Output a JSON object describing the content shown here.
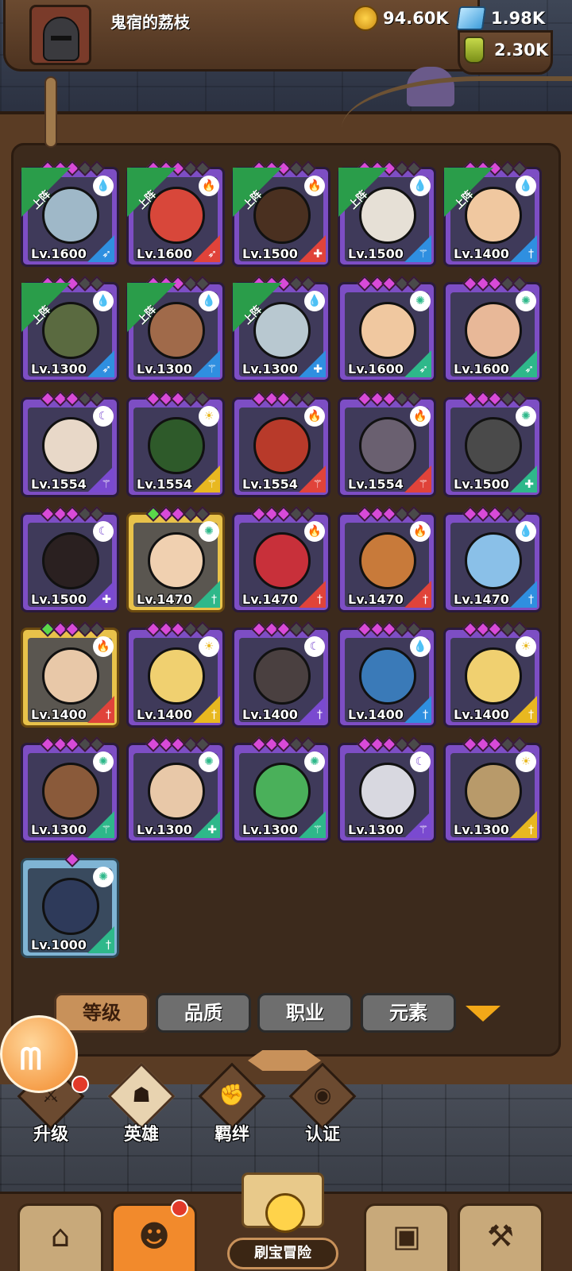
{
  "player": {
    "name": "鬼宿的荔枝"
  },
  "currencies": {
    "gold": "94.60K",
    "gems": "1.98K",
    "potion": "2.30K"
  },
  "heroes": [
    {
      "level": "Lv.1600",
      "deployed": true,
      "frame": "purple",
      "element": "water",
      "class": "archer",
      "face": "#9fb8c8"
    },
    {
      "level": "Lv.1600",
      "deployed": true,
      "frame": "purple",
      "element": "fire",
      "class": "archer",
      "face": "#d8473a"
    },
    {
      "level": "Lv.1500",
      "deployed": true,
      "frame": "purple",
      "element": "fire",
      "class": "tank",
      "face": "#4a3020"
    },
    {
      "level": "Lv.1500",
      "deployed": true,
      "frame": "purple",
      "element": "water",
      "class": "mage",
      "face": "#e6e0d6"
    },
    {
      "level": "Lv.1400",
      "deployed": true,
      "frame": "purple",
      "element": "water",
      "class": "sword",
      "face": "#f0c8a0"
    },
    {
      "level": "Lv.1300",
      "deployed": true,
      "frame": "purple",
      "element": "water",
      "class": "archer",
      "face": "#5a6a40"
    },
    {
      "level": "Lv.1300",
      "deployed": true,
      "frame": "purple",
      "element": "water",
      "class": "mage",
      "face": "#a06a4a"
    },
    {
      "level": "Lv.1300",
      "deployed": true,
      "frame": "purple",
      "element": "water",
      "class": "tank",
      "face": "#b8c8d0"
    },
    {
      "level": "Lv.1600",
      "deployed": false,
      "frame": "purple",
      "element": "wind",
      "class": "archer",
      "face": "#f0c8a0"
    },
    {
      "level": "Lv.1600",
      "deployed": false,
      "frame": "purple",
      "element": "wind",
      "class": "archer",
      "face": "#e8b898"
    },
    {
      "level": "Lv.1554",
      "deployed": false,
      "frame": "purple",
      "element": "dark",
      "class": "mage",
      "face": "#e8d8c8"
    },
    {
      "level": "Lv.1554",
      "deployed": false,
      "frame": "purple",
      "element": "light",
      "class": "mage",
      "face": "#2e5a2a"
    },
    {
      "level": "Lv.1554",
      "deployed": false,
      "frame": "purple",
      "element": "fire",
      "class": "mage",
      "face": "#b83a2a"
    },
    {
      "level": "Lv.1554",
      "deployed": false,
      "frame": "purple",
      "element": "fire",
      "class": "mage",
      "face": "#6a6070"
    },
    {
      "level": "Lv.1500",
      "deployed": false,
      "frame": "purple",
      "element": "wind",
      "class": "tank",
      "face": "#4a4a4a"
    },
    {
      "level": "Lv.1500",
      "deployed": false,
      "frame": "purple",
      "element": "dark",
      "class": "tank",
      "face": "#2a2020"
    },
    {
      "level": "Lv.1470",
      "deployed": false,
      "frame": "gold",
      "element": "wind",
      "class": "sword",
      "face": "#f0d0b0"
    },
    {
      "level": "Lv.1470",
      "deployed": false,
      "frame": "purple",
      "element": "fire",
      "class": "sword",
      "face": "#c8303a"
    },
    {
      "level": "Lv.1470",
      "deployed": false,
      "frame": "purple",
      "element": "fire",
      "class": "sword",
      "face": "#c87a3a"
    },
    {
      "level": "Lv.1470",
      "deployed": false,
      "frame": "purple",
      "element": "water",
      "class": "sword",
      "face": "#8ac0e8"
    },
    {
      "level": "Lv.1400",
      "deployed": false,
      "frame": "gold",
      "element": "fire",
      "class": "sword",
      "face": "#e8c8a8"
    },
    {
      "level": "Lv.1400",
      "deployed": false,
      "frame": "purple",
      "element": "light",
      "class": "sword",
      "face": "#f0d070"
    },
    {
      "level": "Lv.1400",
      "deployed": false,
      "frame": "purple",
      "element": "dark",
      "class": "sword",
      "face": "#4a4040"
    },
    {
      "level": "Lv.1400",
      "deployed": false,
      "frame": "purple",
      "element": "water",
      "class": "sword",
      "face": "#3a7ab8"
    },
    {
      "level": "Lv.1400",
      "deployed": false,
      "frame": "purple",
      "element": "light",
      "class": "sword",
      "face": "#f0d070"
    },
    {
      "level": "Lv.1300",
      "deployed": false,
      "frame": "purple",
      "element": "wind",
      "class": "mage",
      "face": "#8a5a3a"
    },
    {
      "level": "Lv.1300",
      "deployed": false,
      "frame": "purple",
      "element": "wind",
      "class": "tank",
      "face": "#e8c8a8"
    },
    {
      "level": "Lv.1300",
      "deployed": false,
      "frame": "purple",
      "element": "wind",
      "class": "mage",
      "face": "#4ab05a"
    },
    {
      "level": "Lv.1300",
      "deployed": false,
      "frame": "purple",
      "element": "dark",
      "class": "mage",
      "face": "#d8d8e0"
    },
    {
      "level": "Lv.1300",
      "deployed": false,
      "frame": "purple",
      "element": "light",
      "class": "sword",
      "face": "#b89a6a"
    },
    {
      "level": "Lv.1000",
      "deployed": false,
      "frame": "blue",
      "element": "wind",
      "class": "sword",
      "face": "#2e3a5a"
    }
  ],
  "deployed_label": "上阵",
  "sort_tabs": [
    "等级",
    "品质",
    "职业",
    "元素"
  ],
  "sub_nav": [
    {
      "label": "升级",
      "icon": "upgrade-icon",
      "glyph": "⚔"
    },
    {
      "label": "英雄",
      "icon": "hero-icon",
      "glyph": "☗"
    },
    {
      "label": "羁绊",
      "icon": "bond-icon",
      "glyph": "✊"
    },
    {
      "label": "认证",
      "icon": "certify-icon",
      "glyph": "◉"
    }
  ],
  "bottom_nav": [
    {
      "icon": "shop-icon",
      "glyph": "⌂"
    },
    {
      "icon": "heroes-icon",
      "glyph": "☻"
    },
    {
      "icon": "bag-icon",
      "glyph": "▣"
    },
    {
      "icon": "forge-icon",
      "glyph": "⚒"
    }
  ],
  "adventure_label": "刷宝冒险",
  "colors": {
    "water": "#2f8fe0",
    "fire": "#e0433a",
    "wind": "#2eb88a",
    "dark": "#7a4ad0",
    "light": "#e8b820",
    "frame_purple": "#7d4ec4",
    "frame_gold": "#e8c24a",
    "frame_blue": "#7fb4d4",
    "accent_orange": "#f28a2c"
  }
}
